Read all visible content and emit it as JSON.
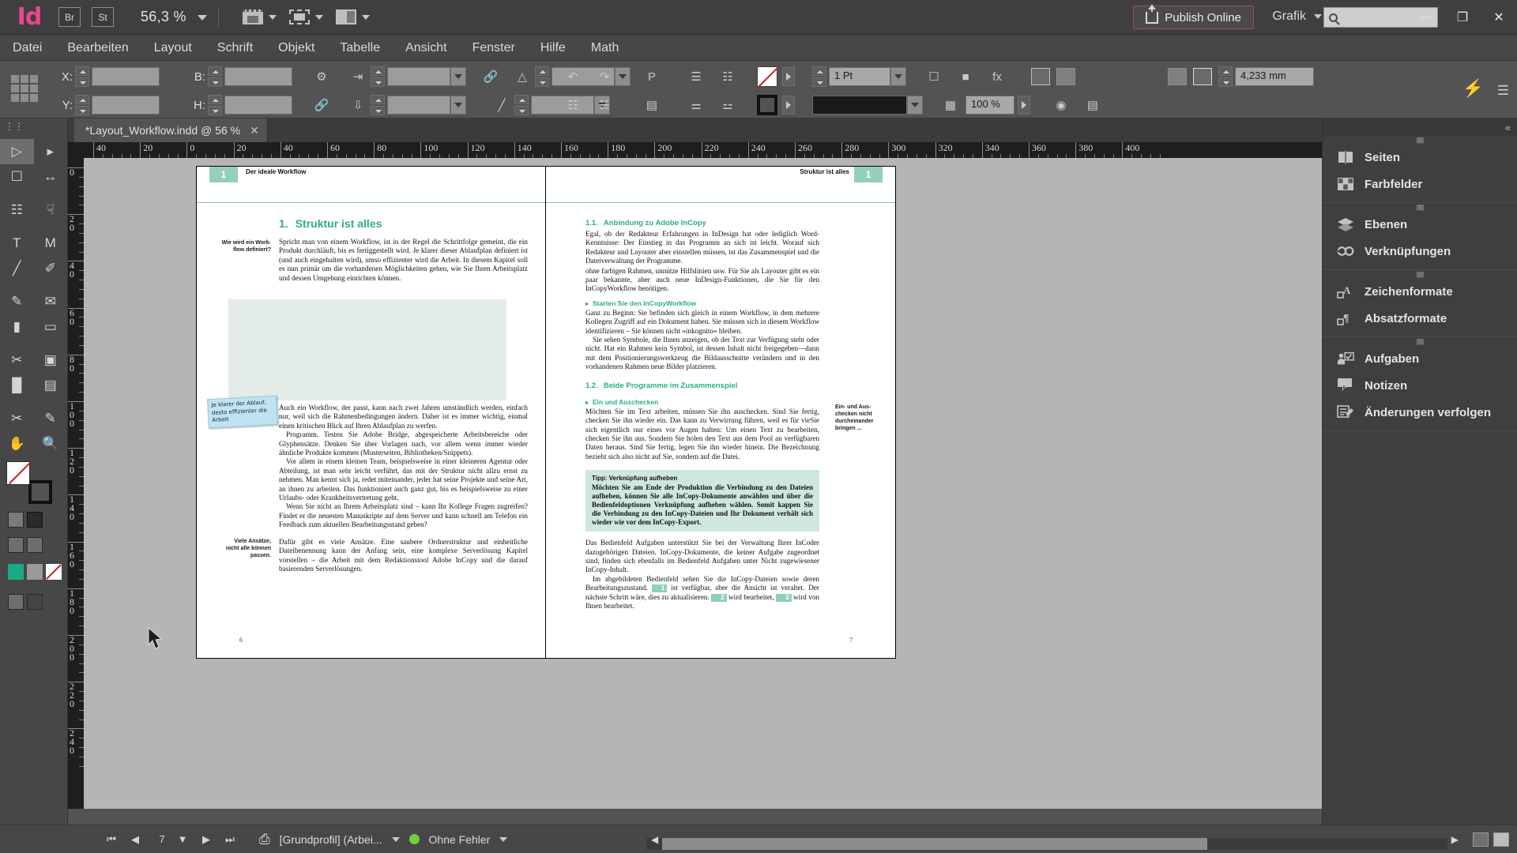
{
  "app": {
    "logo": "Id",
    "bridge_button": "Br",
    "stock_button": "St",
    "zoom_level": "56,3 %",
    "publish_button": "Publish Online",
    "workspace": "Grafik",
    "search_placeholder": "",
    "win_minimize": "—",
    "win_restore": "❐",
    "win_close": "✕"
  },
  "menu": {
    "items": [
      "Datei",
      "Bearbeiten",
      "Layout",
      "Schrift",
      "Objekt",
      "Tabelle",
      "Ansicht",
      "Fenster",
      "Hilfe",
      "Math"
    ]
  },
  "control_panel": {
    "x_label": "X:",
    "y_label": "Y:",
    "w_label": "B:",
    "h_label": "H:",
    "x_value": "",
    "y_value": "",
    "w_value": "",
    "h_value": "",
    "rotate_value": "",
    "shear_value": "",
    "scale_x_value": "",
    "scale_y_value": "",
    "stroke_weight": "1 Pt",
    "opacity": "100 %",
    "text_wrap_offset": "4,233 mm",
    "effects_label": "fx"
  },
  "document_tab": {
    "title": "*Layout_Workflow.indd @ 56 %",
    "close": "✕"
  },
  "rulers": {
    "horizontal_ticks": [
      "40",
      "20",
      "0",
      "20",
      "40",
      "60",
      "80",
      "100",
      "120",
      "140",
      "160",
      "180",
      "200",
      "220",
      "240",
      "260",
      "280",
      "300",
      "320",
      "340",
      "360",
      "380",
      "400"
    ],
    "vertical_ticks": [
      "0",
      "20",
      "40",
      "60",
      "80",
      "100",
      "120",
      "140",
      "160",
      "180",
      "200",
      "220",
      "240"
    ]
  },
  "left_page": {
    "folio": "1",
    "running_head": "Der ideale Workflow",
    "heading_number": "1.",
    "heading": "Struktur ist alles",
    "margin_note_1": "Wie wird ein Work-\nflow definiert?",
    "para_1": "Spricht man von einem Workflow, ist in der Regel die Schrittfolge gemeint, die ein Produkt durchläuft, bis es fertiggestellt wird. Je klarer dieser Ablaufplan definiert ist (und auch eingehalten wird), umso effizienter wird die Arbeit. In diesem Kapitel soll es nun primär um die vorhandenen Möglichkeiten gehen, wie Sie Ihren Arbeitsplatz und dessen Umgebung einrichten können.",
    "sticky_note": "Je klarer der Ablauf,\ndesto effizienter die\nArbeit",
    "para_2": "Auch ein Workflow, der passt, kann nach zwei Jahren umständlich werden, einfach nur, weil sich die Rahmenbedingungen ändern. Daher ist es immer wichtig, einmal einen kritischen Blick auf Ihren Ablaufplan zu werfen.",
    "para_3": "Programm. Testen Sie Adobe Bridge, abgespeicherte Arbeitsbereiche oder Glyphensätze. Denken Sie über Vorlagen nach, vor allem wenn immer wieder ähnliche Produkte kommen (Musterseiten, Bibliotheken/Snippets).",
    "para_4": "Vor allem in einem kleinen Team, beispielsweise in einer kleineren Agentur oder Abteilung, ist man sehr leicht verführt, das mit der Struktur nicht allzu ernst zu nehmen. Man kennt sich ja, redet miteinander, jeder hat seine Projekte und seine Art, an ihnen zu arbeiten. Das funktioniert auch ganz gut, bis es beispielsweise zu einer Urlaubs- oder Krankheitsvertretung geht.",
    "para_5": "Wenn Sie nicht an Ihrem Arbeitsplatz sind – kann Ihr Kollege Fragen zugreifen? Findet er die neuesten Manuskripte auf dem Server und kann schnell am Telefon ein Feedback zum aktuellen Bearbeitungsstand geben?",
    "margin_note_2": "Viele Ansätze,\nnicht alle können\npassen.",
    "para_6": "Dafür gibt es viele Ansätze. Eine saubere Ordnerstruktur und einheitliche Dateibenennung kann der Anfang sein, eine komplexe Serverlösung Kapitel vorstellen – die Arbeit mit dem Redaktionstool Adobe InCopy und die darauf basierenden Serverlösungen.",
    "page_number": "6"
  },
  "right_page": {
    "folio": "1",
    "running_head": "Struktur ist alles",
    "h2_1_num": "1.1.",
    "h2_1": "Anbindung zu Adobe InCopy",
    "para_1": "Egal, ob der Redakteur Erfahrungen in InDesign hat oder lediglich Word-Kenntnisse: Der Einstieg in das Programm an sich ist leicht. Worauf sich Redakteur und Layouter aber einstellen müssen, ist das Zusammenspiel und die Dateiverwaltung der Programme.",
    "para_2": "ohne farbigen Rahmen, unnütze Hilfslinien usw. Für Sie als Layouter gibt es ein paar bekannte, aber auch neue InDesign-Funktionen, die Sie für den InCopyWorkflow benötigen.",
    "h3_1": "Starten Sie den InCopyWorkflow",
    "para_3": "Ganz zu Beginn: Sie befinden sich gleich in einem Workflow, in dem mehrere Kollegen Zugriff auf ein Dokument haben. Sie müssen sich in diesem Workflow identifizieren – Sie können nicht »inkognito« bleiben.",
    "para_4": "Sie sehen Symbole, die Ihnen anzeigen, ob der Text zur Verfügung steht oder nicht. Hat ein Rahmen kein Symbol, ist dessen Inhalt nicht freigegeben—dann mit dem Positionierungswerkzeug die Bildausschnitte verändern und in den vorhandenen Rahmen neue Bilder platzieren.",
    "h2_2_num": "1.2.",
    "h2_2": "Beide Programme im Zusammenspiel",
    "h3_2": "Ein und Auschecken",
    "para_5": "Möchten Sie im Text arbeiten, müssen Sie ihn auschecken. Sind Sie fertig, checken Sie ihn wieder ein. Das kann zu Verwirrung führen, weil es für vieSie sich eigentlich nur eines vor Augen halten: Um einen Text zu bearbeiten, checken Sie ihn aus. Sondern Sie holen den Text aus dem Pool an verfügbaren Daten heraus. Sind Sie fertig, legen Sie ihn wieder hinein. Die Bezeichnung bezieht sich also nicht auf Sie, sondern auf die Datei.",
    "margin_note": "Ein- und Aus-\nchecken nicht\ndurcheinander\nbringen ...",
    "tip_title": "Tipp: Verknüpfung aufheben",
    "tip_body": "Möchten Sie am Ende der Produktion die Verbindung zu den Dateien aufheben, können Sie alle InCopy-Dokumente anwählen und über die Bedienfeldoptionen Verknüpfung aufheben wählen. Somit kappen Sie die Verbindung zu den InCopy-Dateien und Ihr Dokument verhält sich wieder wie vor dem InCopy-Export.",
    "para_6": "Das Bedienfeld Aufgaben unterstützt Sie bei der Verwaltung Ihrer InCoder dazugehörigen Dateien. InCopy-Dokumente, die keiner Aufgabe zugeordnet sind, finden sich ebenfalls im Bedienfeld Aufgaben unter Nicht zugewiesener InCopy-Inhalt.",
    "para_7_a": "Im abgebildeten Bedienfeld sehen Sie die InCopy-Dateien sowie deren Bearbeitungszustand. ",
    "para_7_n1": "1",
    "para_7_b": " ist verfügbar, aber die Ansicht ist veraltet. Der nächste Schritt wäre, dies zu aktualisieren. ",
    "para_7_n2": "2",
    "para_7_c": " wird bearbeitet, ",
    "para_7_n3": "3",
    "para_7_d": " wird von Ihnen bearbeitet.",
    "page_number": "7"
  },
  "dock": {
    "collapse": "«",
    "groups": [
      {
        "items": [
          {
            "label": "Seiten",
            "icon": "pages-icon"
          },
          {
            "label": "Farbfelder",
            "icon": "swatches-icon"
          }
        ]
      },
      {
        "items": [
          {
            "label": "Ebenen",
            "icon": "layers-icon"
          },
          {
            "label": "Verknüpfungen",
            "icon": "links-icon"
          }
        ]
      },
      {
        "items": [
          {
            "label": "Zeichenformate",
            "icon": "character-styles-icon"
          },
          {
            "label": "Absatzformate",
            "icon": "paragraph-styles-icon"
          }
        ]
      },
      {
        "items": [
          {
            "label": "Aufgaben",
            "icon": "assignments-icon"
          },
          {
            "label": "Notizen",
            "icon": "notes-icon"
          },
          {
            "label": "Änderungen verfolgen",
            "icon": "track-changes-icon"
          }
        ]
      }
    ]
  },
  "tools": {
    "items": [
      "selection-tool",
      "direct-selection-tool",
      "page-tool",
      "gap-tool",
      "type-tool",
      "type-on-path-tool",
      "line-tool",
      "pen-tool",
      "pencil-tool",
      "frame-tool",
      "rectangle-tool",
      "ellipse-frame-tool",
      "scissors-tool",
      "free-transform-tool",
      "gradient-swatch-tool",
      "gradient-feather-tool",
      "note-tool",
      "color-theme-tool",
      "hand-tool",
      "zoom-tool"
    ],
    "fill_stroke": "fill-stroke-indicator",
    "apply_color_none": "apply-none",
    "formatting_container": "formatting-affects-container",
    "formatting_text": "formatting-affects-text",
    "normal_view": "normal-view-mode",
    "preview_view": "preview-view-mode"
  },
  "status_bar": {
    "first_page": "⏮",
    "prev_page": "◀",
    "page_value": "7",
    "page_ddl": "▼",
    "next_page": "▶",
    "last_page": "⏭",
    "preflight_profile": "[Grundprofil] (Arbei...",
    "error_status": "Ohne Fehler",
    "status_color": "#6fd13d"
  },
  "colors": {
    "accent_green": "#2bab8a",
    "folio_green": "#95cdbe",
    "tip_green": "#cfe7de",
    "brand_pink": "#e8468f",
    "chrome": "#535353"
  }
}
